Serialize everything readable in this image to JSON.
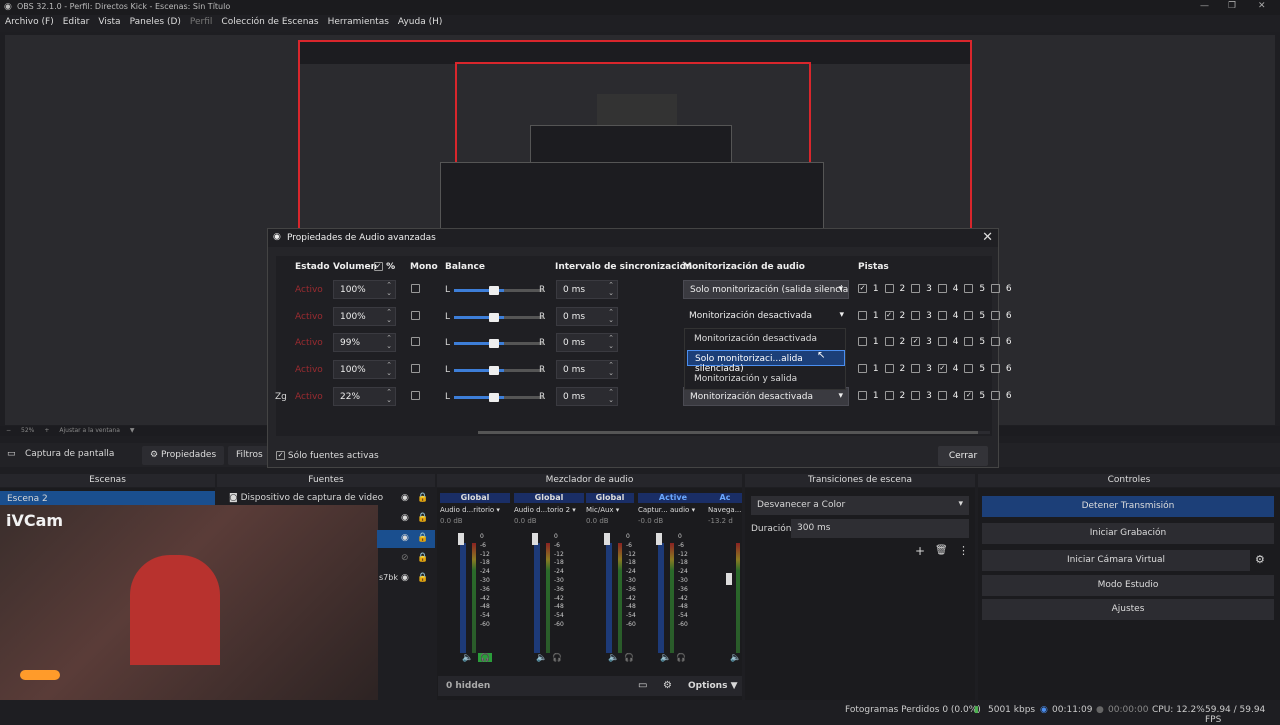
{
  "window": {
    "title": "OBS 32.1.0 - Perfil: Directos Kick - Escenas: Sin Título"
  },
  "menu": [
    {
      "label": "Archivo (F)",
      "disabled": false
    },
    {
      "label": "Editar",
      "disabled": false
    },
    {
      "label": "Vista",
      "disabled": false
    },
    {
      "label": "Paneles (D)",
      "disabled": false
    },
    {
      "label": "Perfil",
      "disabled": true
    },
    {
      "label": "Colección de Escenas",
      "disabled": false
    },
    {
      "label": "Herramientas",
      "disabled": false
    },
    {
      "label": "Ayuda (H)",
      "disabled": false
    }
  ],
  "zoom": {
    "value": "52%",
    "fit": "Ajustar a la ventana"
  },
  "source_toolbar": {
    "source": "Captura de pantalla",
    "properties": "Propiedades",
    "filters": "Filtros"
  },
  "dialog": {
    "title": "Propiedades de Audio avanzadas",
    "headers": {
      "status": "Estado",
      "volume": "Volumen",
      "percent": "%",
      "mono": "Mono",
      "balance": "Balance",
      "sync": "Intervalo de sincronización",
      "monitoring": "Monitorización de audio",
      "tracks": "Pistas"
    },
    "rows": [
      {
        "prefix": "",
        "status": "Activo",
        "volume": "100%",
        "sync": "0 ms",
        "monitoring": "Solo monitorización (salida silencia",
        "tracks": [
          true,
          false,
          false,
          false,
          false,
          false
        ]
      },
      {
        "prefix": "",
        "status": "Activo",
        "volume": "100%",
        "sync": "0 ms",
        "monitoring": "Monitorización desactivada",
        "tracks": [
          false,
          true,
          false,
          false,
          false,
          false
        ]
      },
      {
        "prefix": "",
        "status": "Activo",
        "volume": "99%",
        "sync": "0 ms",
        "monitoring": "",
        "tracks": [
          false,
          false,
          true,
          false,
          false,
          false
        ]
      },
      {
        "prefix": "",
        "status": "Activo",
        "volume": "100%",
        "sync": "0 ms",
        "monitoring": "",
        "tracks": [
          false,
          false,
          false,
          true,
          false,
          false
        ]
      },
      {
        "prefix": "Zg",
        "status": "Activo",
        "volume": "22%",
        "sync": "0 ms",
        "monitoring": "Monitorización desactivada",
        "tracks": [
          false,
          false,
          false,
          false,
          true,
          false
        ]
      }
    ],
    "balance_L": "L",
    "balance_R": "R",
    "track_labels": [
      "1",
      "2",
      "3",
      "4",
      "5",
      "6"
    ],
    "dropdown_options": [
      "Monitorización desactivada",
      "Solo monitorizaci...alida silenciada)",
      "Monitorización y salida"
    ],
    "dropdown_selected": 1,
    "active_only_label": "Sólo fuentes activas",
    "close_label": "Cerrar"
  },
  "docks": {
    "scenes": "Escenas",
    "sources": "Fuentes",
    "mixer": "Mezclador de audio",
    "transitions": "Transiciones de escena",
    "controls": "Controles"
  },
  "scenes": {
    "items": [
      "Escena 2"
    ]
  },
  "camera_label": "iVCam",
  "sources": {
    "items": [
      "Dispositivo de captura de video"
    ],
    "partial": "s7bk"
  },
  "mixer": {
    "channels": [
      {
        "tag": "Global",
        "name": "Audio d...ritorio",
        "db": "0.0 dB"
      },
      {
        "tag": "Global",
        "name": "Audio d...torio 2",
        "db": "0.0 dB"
      },
      {
        "tag": "Global",
        "name": "Mic/Aux",
        "db": "0.0 dB"
      },
      {
        "tag": "Active",
        "name": "Captur... audio",
        "db": "-0.0 dB"
      },
      {
        "tag": "Ac",
        "name": "Navega...",
        "db": "-13.2 d"
      }
    ],
    "scale": [
      "0",
      "-6",
      "-12",
      "-18",
      "-24",
      "-30",
      "-36",
      "-42",
      "-48",
      "-54",
      "-60"
    ],
    "hidden": "0 hidden",
    "options": "Options"
  },
  "transitions": {
    "selected": "Desvanecer a Color",
    "duration_label": "Duración",
    "duration": "300 ms"
  },
  "controls": {
    "buttons": [
      "Detener Transmisión",
      "Iniciar Grabación",
      "Iniciar Cámara Virtual",
      "Modo Estudio",
      "Ajustes"
    ]
  },
  "status": {
    "dropped": "Fotogramas Perdidos 0 (0.0%)",
    "bitrate": "5001 kbps",
    "stream_time": "00:11:09",
    "rec_time": "00:00:00",
    "cpu": "CPU: 12.2%",
    "fps": "59.94 / 59.94 FPS"
  },
  "colors": {
    "accent": "#1c3f78",
    "record_red": "#d9262c",
    "status_inactive": "#9b2b30"
  }
}
